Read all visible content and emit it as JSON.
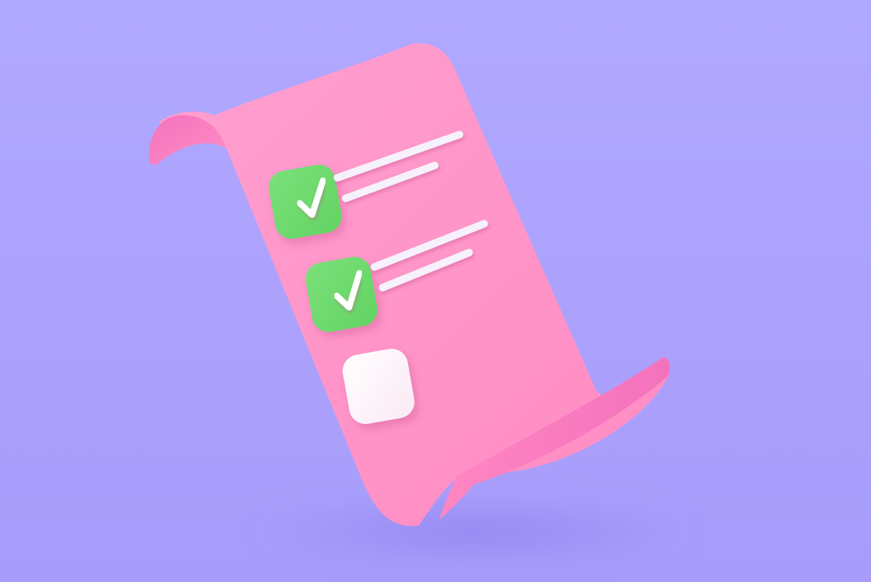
{
  "scene": {
    "subject": "checklist-illustration",
    "colors": {
      "background": "#b1a8ff",
      "background_floor": "#a79cfa",
      "paper": "#ff94c8",
      "paper_curl_inner": "#f472bd",
      "checkbox_checked": "#62d462",
      "checkbox_unchecked": "#fbe9f5",
      "checkmark": "#ffffff",
      "text_line": "#f6f1fb"
    }
  },
  "checklist": {
    "items": [
      {
        "checked": true,
        "text_lines": 2
      },
      {
        "checked": true,
        "text_lines": 2
      },
      {
        "checked": false,
        "text_lines": 0
      }
    ]
  }
}
